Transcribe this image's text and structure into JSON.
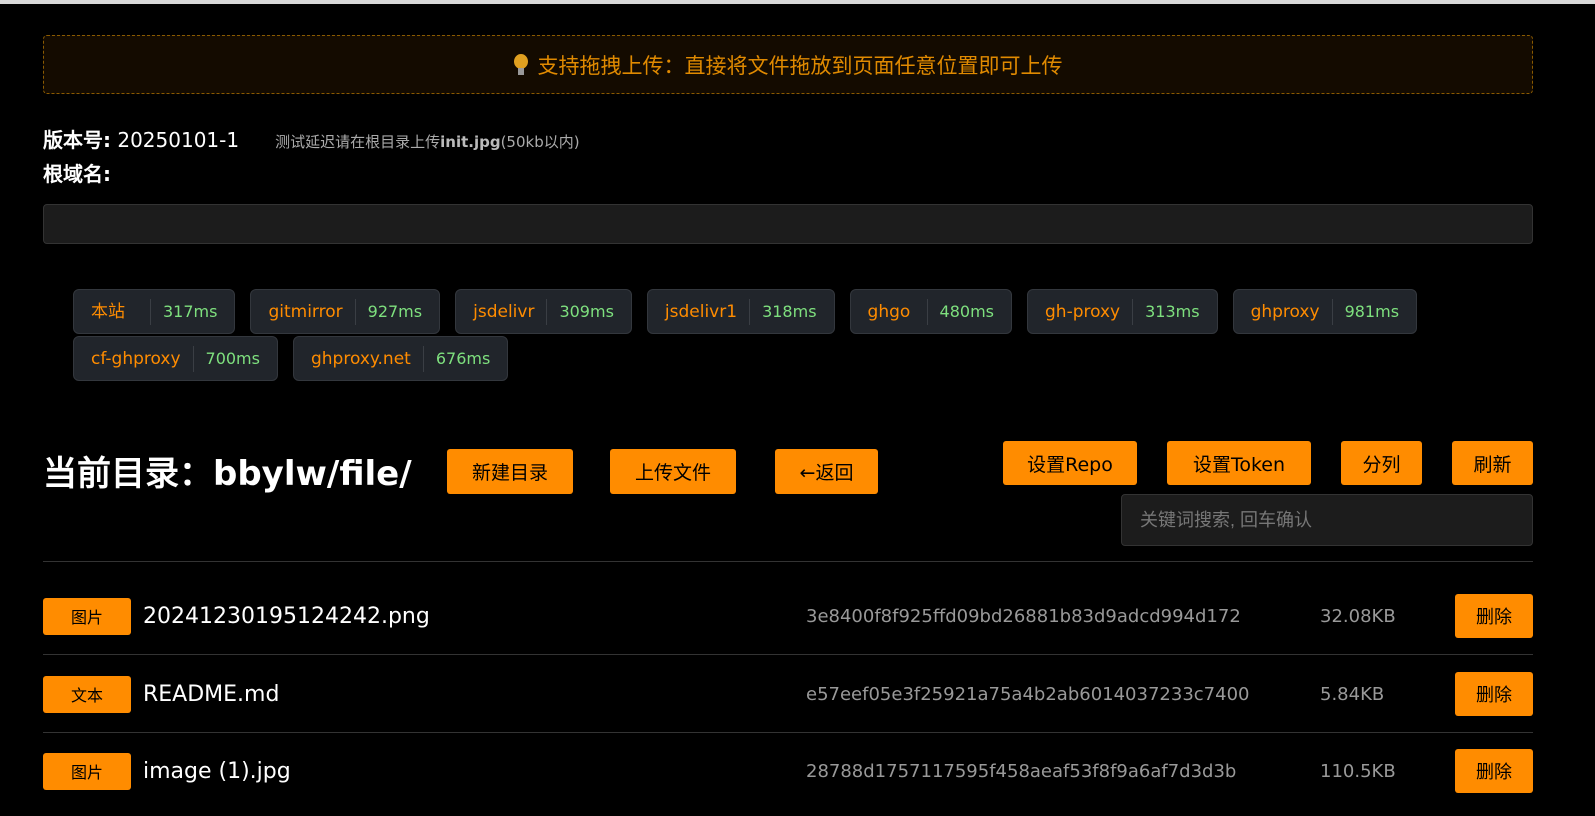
{
  "banner": {
    "icon": "lightbulb-icon",
    "text": "支持拖拽上传：直接将文件拖放到页面任意位置即可上传"
  },
  "version": {
    "label": "版本号:",
    "value": "20250101-1",
    "hint_prefix": "测试延迟请在根目录上传",
    "hint_file": "init.jpg",
    "hint_suffix": "(50kb以内)"
  },
  "root": {
    "label": "根域名:",
    "value": ""
  },
  "mirrors": [
    {
      "name": "本站",
      "latency": "317ms"
    },
    {
      "name": "gitmirror",
      "latency": "927ms"
    },
    {
      "name": "jsdelivr",
      "latency": "309ms"
    },
    {
      "name": "jsdelivr1",
      "latency": "318ms"
    },
    {
      "name": "ghgo",
      "latency": "480ms"
    },
    {
      "name": "gh-proxy",
      "latency": "313ms"
    },
    {
      "name": "ghproxy",
      "latency": "981ms"
    },
    {
      "name": "cf-ghproxy",
      "latency": "700ms"
    },
    {
      "name": "ghproxy.net",
      "latency": "676ms"
    }
  ],
  "directory": {
    "label": "当前目录：bbylw/file/"
  },
  "toolbar": {
    "new_dir": "新建目录",
    "upload": "上传文件",
    "back": "←返回",
    "set_repo": "设置Repo",
    "set_token": "设置Token",
    "columns": "分列",
    "refresh": "刷新",
    "search_placeholder": "关键词搜索, 回车确认"
  },
  "files": [
    {
      "type": "图片",
      "name": "20241230195124242.png",
      "sha": "3e8400f8f925ffd09bd26881b83d9adcd994d172",
      "size": "32.08KB",
      "action": "删除"
    },
    {
      "type": "文本",
      "name": "README.md",
      "sha": "e57eef05e3f25921a75a4b2ab6014037233c7400",
      "size": "5.84KB",
      "action": "删除"
    },
    {
      "type": "图片",
      "name": "image (1).jpg",
      "sha": "28788d1757117595f458aeaf53f8f9a6af7d3d3b",
      "size": "110.5KB",
      "action": "删除"
    }
  ],
  "colors": {
    "accent": "#ff8c00",
    "latency": "#7ee07e"
  }
}
